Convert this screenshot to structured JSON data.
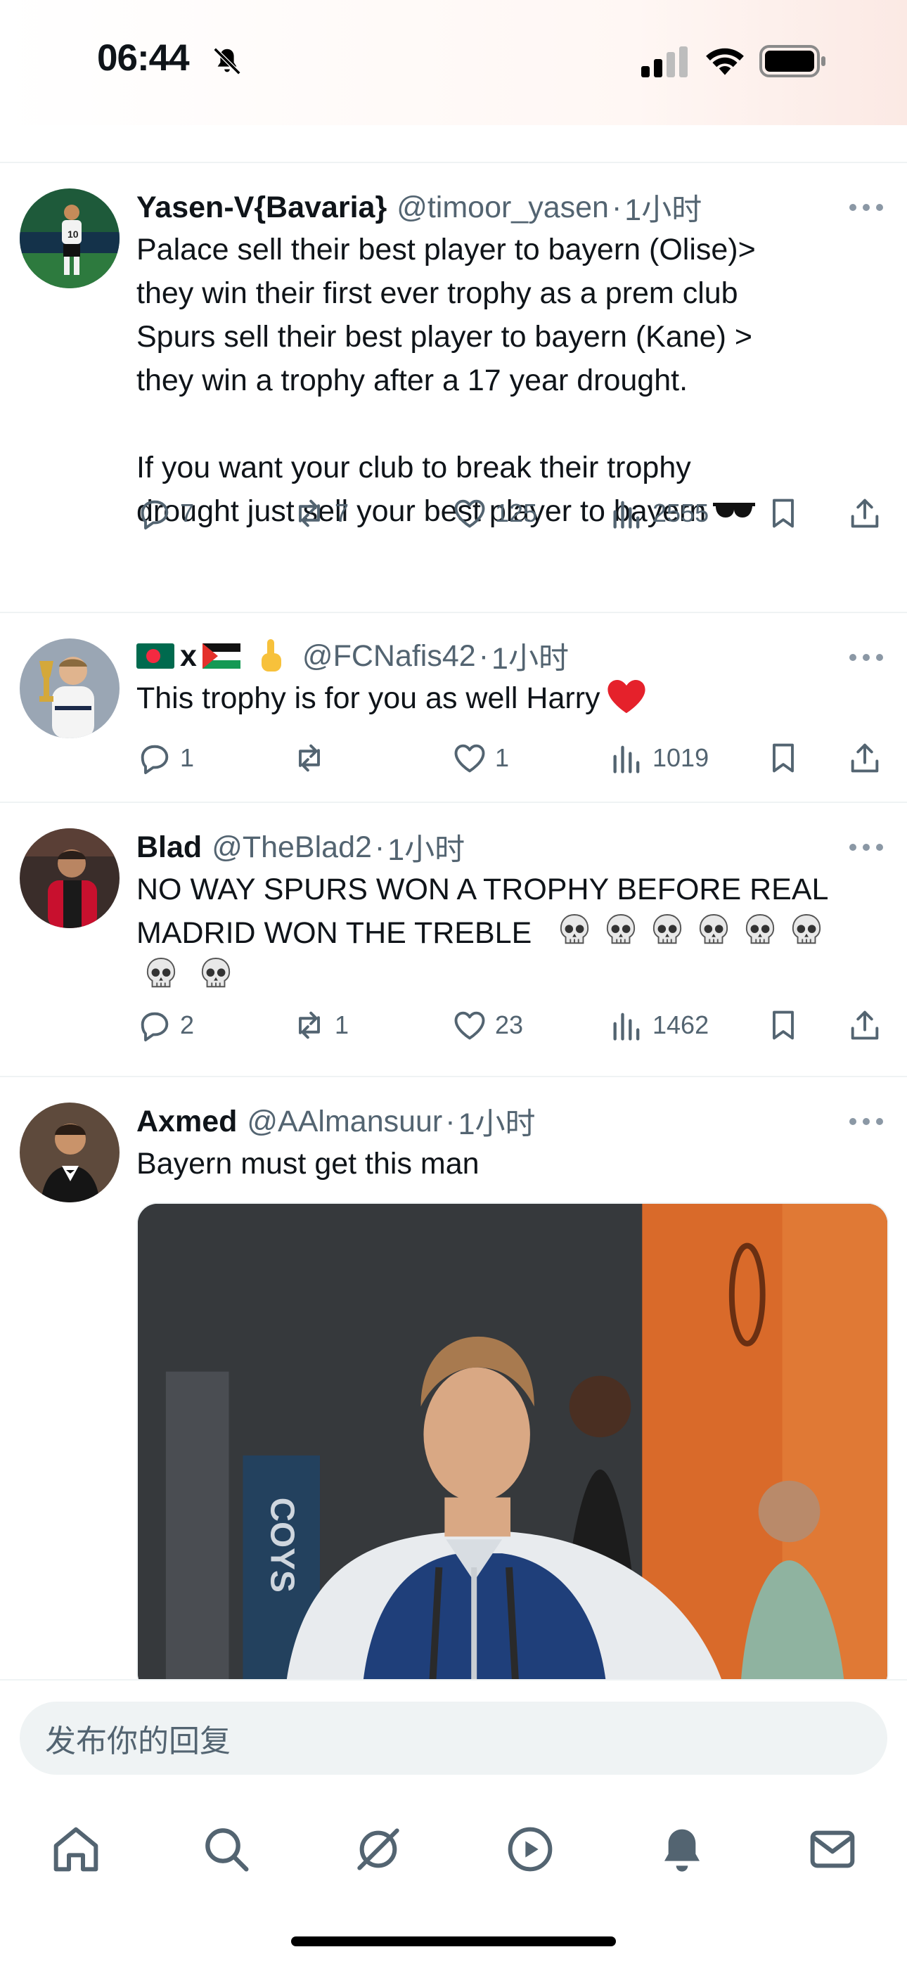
{
  "status_bar": {
    "time": "06:44"
  },
  "tweets": [
    {
      "name": "Yasen-V{Bavaria}",
      "handle": "@timoor_yasen",
      "time": "1小时",
      "text_lines": [
        "Palace sell their best player to bayern (Olise)>",
        "they win their first ever trophy as a prem club",
        "Spurs sell their best player to bayern (Kane) >",
        "they win a trophy after a 17 year drought."
      ],
      "text_lines_2": [
        "If you want your club to break their trophy",
        "drought just sell your best player to bayern"
      ],
      "replies": "7",
      "retweets": "7",
      "likes": "125",
      "views": "2555"
    },
    {
      "name": "x",
      "handle": "@FCNafis42",
      "time": "1小时",
      "text": "This trophy is for you as well Harry",
      "replies": "1",
      "retweets": "",
      "likes": "1",
      "views": "1019"
    },
    {
      "name": "Blad",
      "handle": "@TheBlad2",
      "time": "1小时",
      "text_line1": "NO WAY SPURS WON A TROPHY BEFORE REAL",
      "text_line2": "MADRID WON THE TREBLE",
      "replies": "2",
      "retweets": "1",
      "likes": "23",
      "views": "1462"
    },
    {
      "name": "Axmed",
      "handle": "@AAlmansuur",
      "time": "1小时",
      "text": "Bayern must get this man",
      "image_text": "COYS"
    }
  ],
  "reply_bar": {
    "placeholder": "发布你的回复"
  },
  "tab_bar": {
    "items": [
      "home-icon",
      "search-icon",
      "grok-icon",
      "video-icon",
      "notifications-icon",
      "messages-icon"
    ]
  },
  "colors": {
    "text": "#0f1419",
    "secondary": "#536471",
    "divider": "#eff3f4",
    "input_bg": "#eff3f4"
  }
}
